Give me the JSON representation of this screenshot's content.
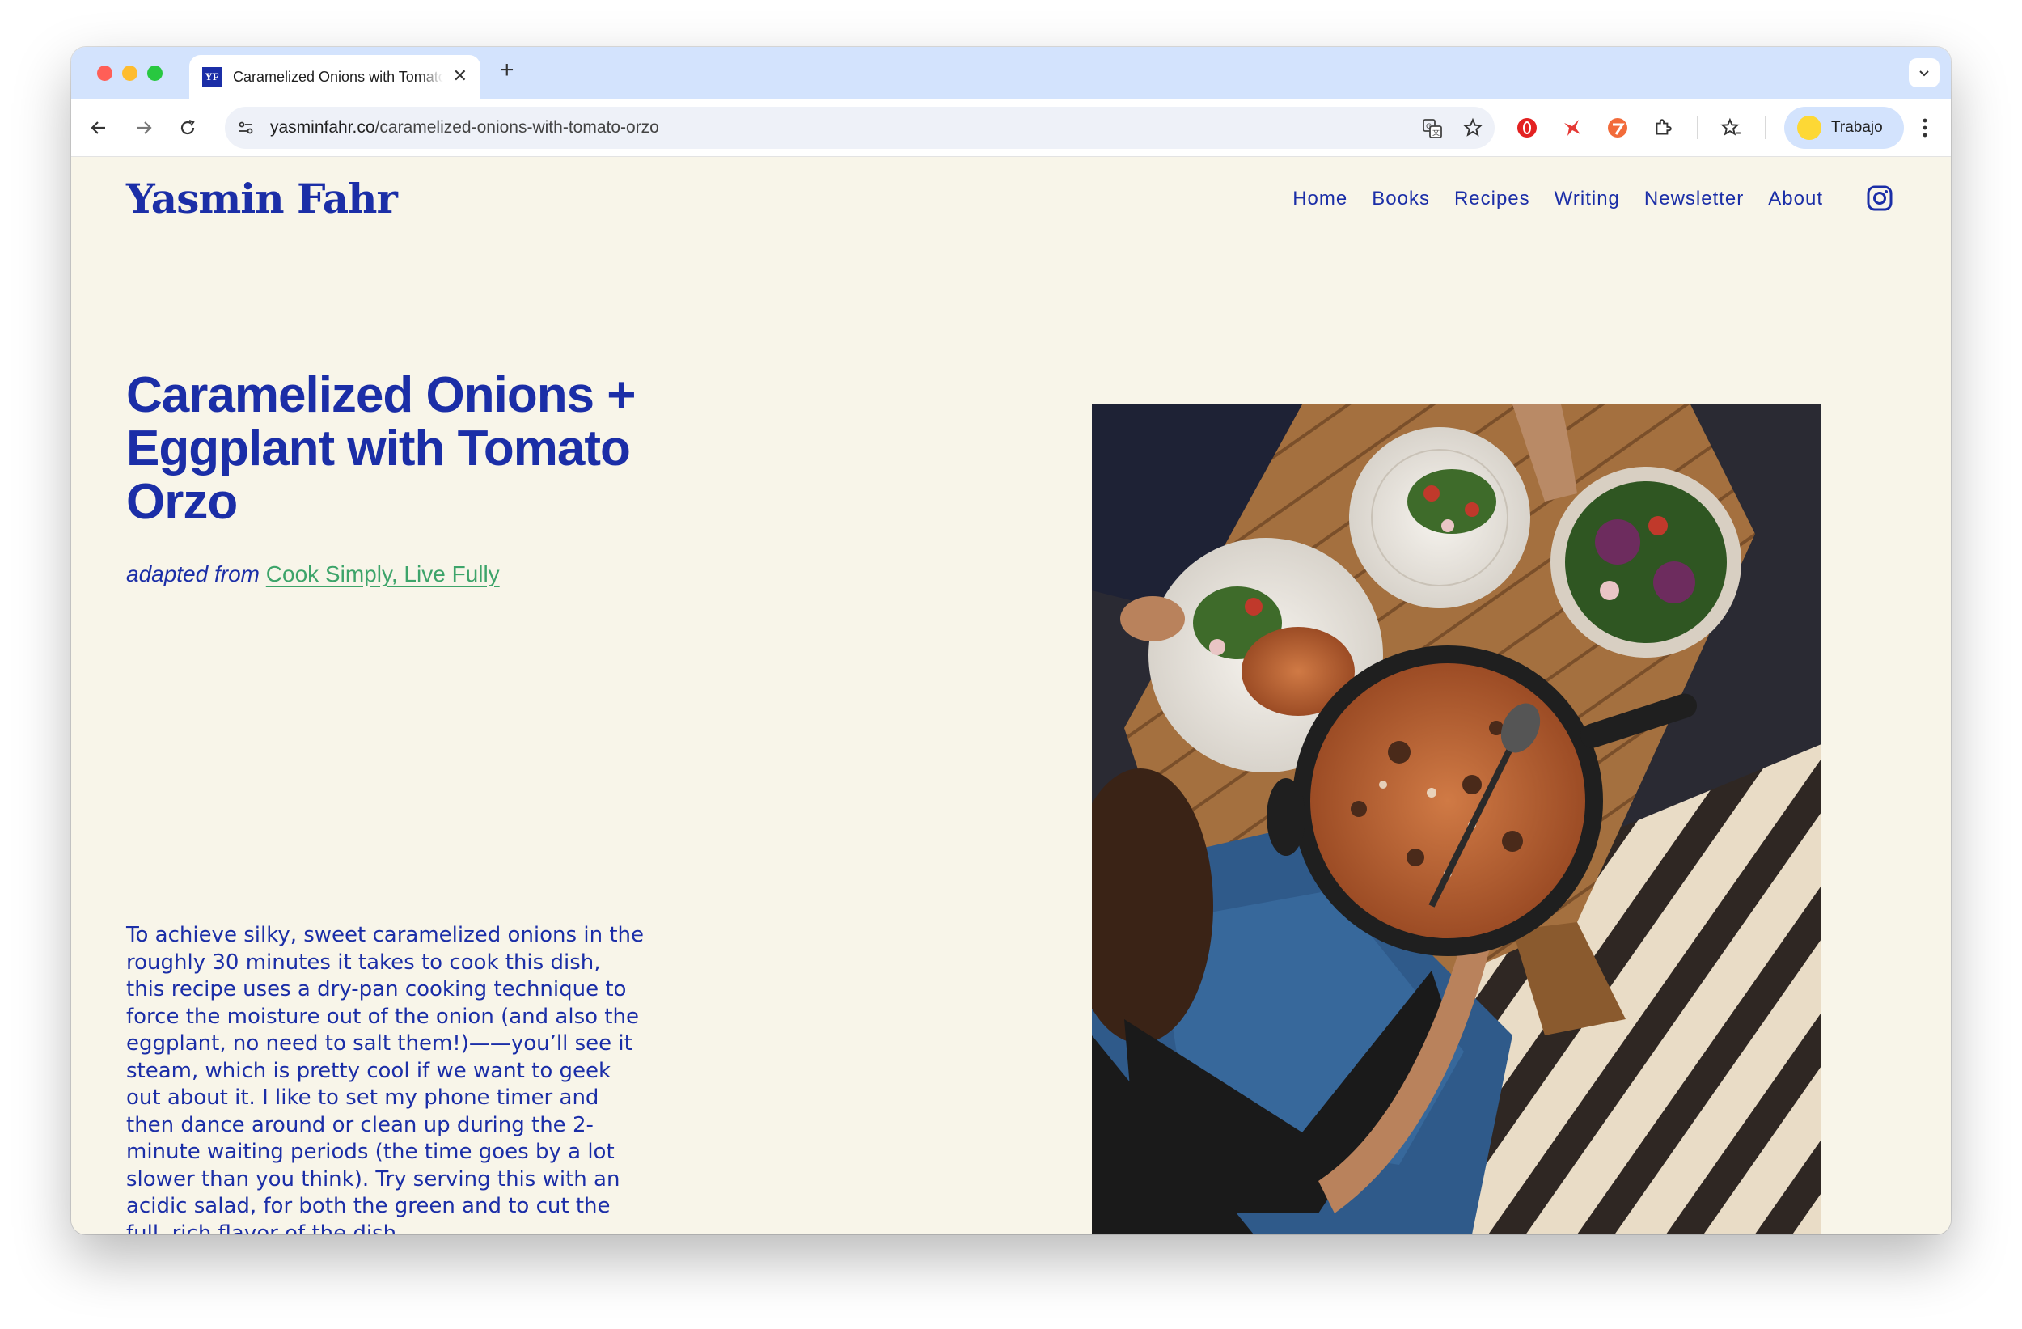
{
  "browser": {
    "tab_title": "Caramelized Onions with Tomato Orzo",
    "favicon_text": "YF",
    "url_domain": "yasminfahr.co",
    "url_path": "/caramelized-onions-with-tomato-orzo",
    "profile_name": "Trabajo"
  },
  "site": {
    "logo": "Yasmin Fahr",
    "nav": [
      "Home",
      "Books",
      "Recipes",
      "Writing",
      "Newsletter",
      "About"
    ]
  },
  "recipe": {
    "title": "Caramelized Onions + Eggplant with Tomato Orzo",
    "adapted_prefix": "adapted from",
    "adapted_link": "Cook Simply, Live Fully",
    "intro": "To achieve silky, sweet caramelized onions in the roughly 30 minutes it takes to cook this dish, this recipe uses a dry-pan cooking technique to force the moisture out of the onion (and also the eggplant, no need to salt them!)——you’ll see it steam, which is pretty cool if we want to geek out about it. I like to set my phone timer and then dance around or clean up during the 2-minute waiting periods (the time goes by a lot slower than you think). Try serving this with an acidic salad, for both the green and to cut the full, rich flavor of the dish."
  },
  "colors": {
    "brand_blue": "#1b2ea7",
    "link_green": "#3da46a",
    "page_bg": "#f8f5e9",
    "tab_bar": "#d3e3fd"
  }
}
